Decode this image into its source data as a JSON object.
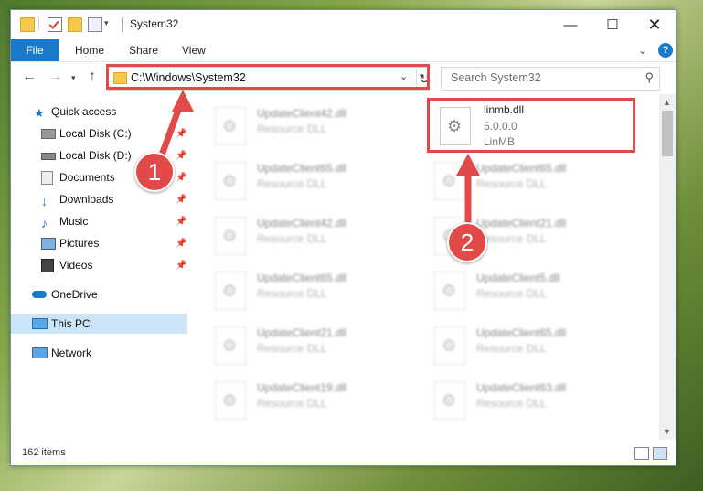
{
  "window": {
    "title": "System32",
    "minimize_icon": "minimize-icon",
    "maximize_icon": "maximize-icon",
    "close_icon": "close-icon"
  },
  "ribbon": {
    "tabs": [
      "File",
      "Home",
      "Share",
      "View"
    ],
    "accent": "#1979ca"
  },
  "navigation": {
    "address": "C:\\Windows\\System32",
    "search_placeholder": "Search System32"
  },
  "sidebar": {
    "items": [
      {
        "label": "Quick access",
        "icon": "star-icon"
      },
      {
        "label": "Local Disk (C:)",
        "icon": "drive-icon"
      },
      {
        "label": "Local Disk (D:)",
        "icon": "drive-icon"
      },
      {
        "label": "Documents",
        "icon": "documents-icon"
      },
      {
        "label": "Downloads",
        "icon": "download-icon"
      },
      {
        "label": "Music",
        "icon": "music-icon"
      },
      {
        "label": "Pictures",
        "icon": "pictures-icon"
      },
      {
        "label": "Videos",
        "icon": "videos-icon"
      },
      {
        "label": "OneDrive",
        "icon": "cloud-icon"
      },
      {
        "label": "This PC",
        "icon": "computer-icon"
      },
      {
        "label": "Network",
        "icon": "network-icon"
      }
    ]
  },
  "files": {
    "highlighted": {
      "name": "linmb.dll",
      "version": "5.0.0.0",
      "company": "LinMB"
    },
    "left_column": [
      {
        "name": "UpdateClient42.dll",
        "type": "Resource DLL"
      },
      {
        "name": "UpdateClient65.dll",
        "type": "Resource DLL"
      },
      {
        "name": "UpdateClient42.dll",
        "type": "Resource DLL"
      },
      {
        "name": "UpdateClient65.dll",
        "type": "Resource DLL"
      },
      {
        "name": "UpdateClient21.dll",
        "type": "Resource DLL"
      },
      {
        "name": "UpdateClient19.dll",
        "type": "Resource DLL"
      }
    ],
    "right_column": [
      {
        "name": "UpdateClient65.dll",
        "type": "Resource DLL"
      },
      {
        "name": "UpdateClient21.dll",
        "type": "Resource DLL"
      },
      {
        "name": "UpdateClient5.dll",
        "type": "Resource DLL"
      },
      {
        "name": "UpdateClient65.dll",
        "type": "Resource DLL"
      },
      {
        "name": "UpdateClient63.dll",
        "type": "Resource DLL"
      }
    ]
  },
  "status": {
    "item_count": "162 items"
  },
  "annotations": {
    "callout_1": "1",
    "callout_2": "2",
    "color": "#e24a4a"
  }
}
